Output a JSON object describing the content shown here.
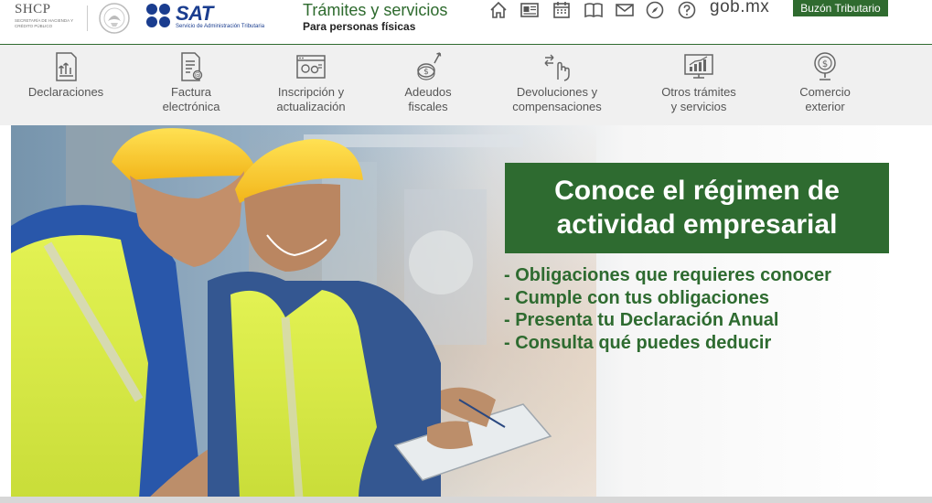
{
  "header": {
    "shcp": {
      "title": "SHCP",
      "subtitle": "SECRETARÍA DE HACIENDA Y CRÉDITO PÚBLICO"
    },
    "sat": {
      "name": "SAT",
      "subtitle": "Servicio de Administración Tributaria"
    },
    "section_title": "Trámites y servicios",
    "section_subtitle": "Para personas físicas",
    "icons": [
      "home-icon",
      "news-icon",
      "calendar-icon",
      "book-icon",
      "mail-icon",
      "compass-icon",
      "help-icon"
    ],
    "gob_label": "gob.mx",
    "buzon_label": "Buzón Tributario"
  },
  "nav": {
    "items": [
      {
        "label": "Declaraciones",
        "icon": "declaraciones-icon"
      },
      {
        "label": "Factura\nelectrónica",
        "icon": "factura-icon"
      },
      {
        "label": "Inscripción y\nactualización",
        "icon": "inscripcion-icon"
      },
      {
        "label": "Adeudos\nfiscales",
        "icon": "adeudos-icon"
      },
      {
        "label": "Devoluciones y\ncompensaciones",
        "icon": "devoluciones-icon"
      },
      {
        "label": "Otros trámites\ny servicios",
        "icon": "otros-tramites-icon"
      },
      {
        "label": "Comercio\nexterior",
        "icon": "comercio-icon"
      }
    ]
  },
  "hero": {
    "headline": "Conoce el régimen de\nactividad empresarial",
    "links": [
      "- Obligaciones que requieres conocer",
      "- Cumple con tus obligaciones",
      "- Presenta tu Declaración Anual",
      "- Consulta qué puedes deducir"
    ]
  },
  "colors": {
    "brand_green": "#2e6b30",
    "sat_blue": "#1a3d8f",
    "nav_bg": "#f0f0f0"
  }
}
